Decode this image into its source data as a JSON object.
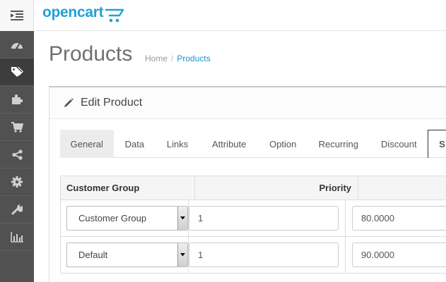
{
  "brand": {
    "logo_text": "opencart"
  },
  "sidebar": {
    "items": [
      {
        "icon": "dashboard-icon",
        "active": false
      },
      {
        "icon": "tags-icon",
        "active": true
      },
      {
        "icon": "puzzle-icon",
        "active": false
      },
      {
        "icon": "shopping-cart-icon",
        "active": false
      },
      {
        "icon": "share-icon",
        "active": false
      },
      {
        "icon": "cog-icon",
        "active": false
      },
      {
        "icon": "wrench-icon",
        "active": false
      },
      {
        "icon": "bar-chart-icon",
        "active": false
      }
    ]
  },
  "page": {
    "title": "Products",
    "breadcrumb": {
      "home": "Home",
      "separator": "/",
      "current": "Products"
    }
  },
  "panel": {
    "title": "Edit Product"
  },
  "tabs": [
    "General",
    "Data",
    "Links",
    "Attribute",
    "Option",
    "Recurring",
    "Discount",
    "S"
  ],
  "table": {
    "headers": [
      "Customer Group",
      "Priority",
      ""
    ],
    "rows": [
      {
        "customer_group": "Customer Group",
        "priority": "1",
        "price": "80.0000"
      },
      {
        "customer_group": "Default",
        "priority": "1",
        "price": "90.0000"
      }
    ]
  },
  "colors": {
    "brand": "#23a1d1",
    "sidebar": "#515151",
    "link": "#1e91cf"
  }
}
